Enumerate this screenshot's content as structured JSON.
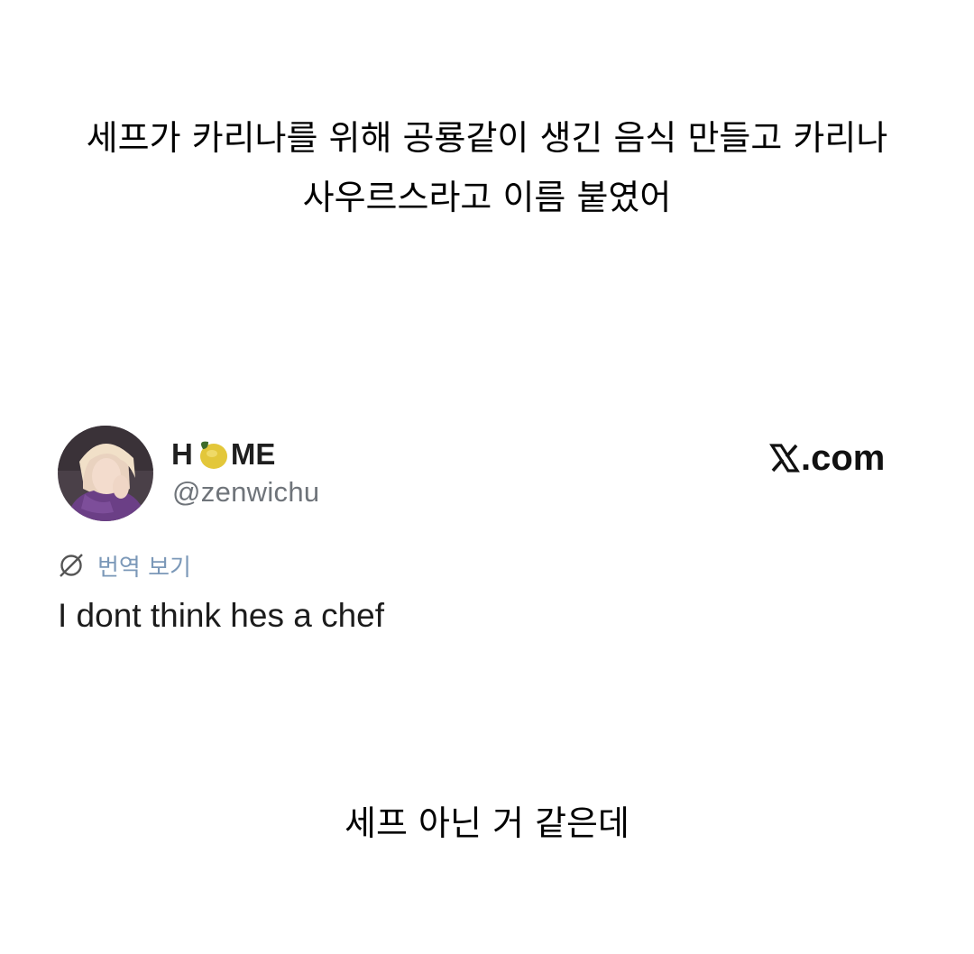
{
  "caption_top": {
    "line1": "세프가 카리나를 위해 공룡같이 생긴 음식 만들고 카리나",
    "line2": "사우르스라고 이름 붙였어"
  },
  "tweet": {
    "display_name_left": "H",
    "display_name_right": "ME",
    "display_name_emoji": "lemon-icon",
    "handle": "@zenwichu",
    "site": ".com",
    "site_icon": "x-logo-icon",
    "translate_label": "번역 보기",
    "text": "I dont think hes a chef"
  },
  "caption_bottom": "세프 아닌 거 같은데",
  "colors": {
    "handle": "#6f747a",
    "translate": "#7b98b8",
    "lemon": "#e3c73a",
    "lemon_leaf": "#3d6b2a",
    "avatar_bg": "#5a4a5a",
    "avatar_hair": "#e6c9b4",
    "avatar_clothes": "#6b3f86"
  }
}
